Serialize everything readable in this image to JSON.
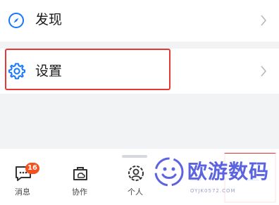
{
  "menu": {
    "discover": {
      "label": "发现",
      "icon": "compass-icon"
    },
    "settings": {
      "label": "设置",
      "icon": "gear-icon"
    }
  },
  "tabbar": {
    "tabs": [
      {
        "label": "消息",
        "icon": "chat-bubble-icon",
        "badge": "16"
      },
      {
        "label": "协作",
        "icon": "briefcase-cloud-icon"
      },
      {
        "label": "个人",
        "icon": "person-icon"
      },
      {
        "label": "",
        "icon": "contacts-icon"
      },
      {
        "label": "",
        "icon": "me-icon"
      }
    ]
  },
  "watermark": {
    "title": "欧游数码",
    "subtitle": "OYJK0572.COM"
  },
  "colors": {
    "accent": "#1677ff",
    "highlight": "#e53935",
    "badge": "#f4511e",
    "watermark": "#5b63e0"
  }
}
